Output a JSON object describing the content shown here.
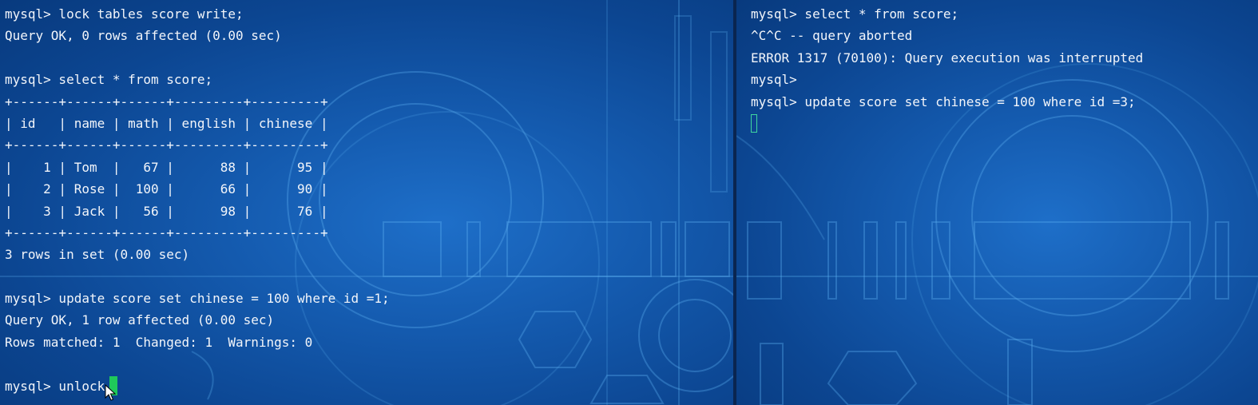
{
  "left_terminal": {
    "lines": [
      "mysql> lock tables score write;",
      "Query OK, 0 rows affected (0.00 sec)",
      "",
      "mysql> select * from score;",
      "+------+------+------+---------+---------+",
      "| id   | name | math | english | chinese |",
      "+------+------+------+---------+---------+",
      "|    1 | Tom  |   67 |      88 |      95 |",
      "|    2 | Rose |  100 |      66 |      90 |",
      "|    3 | Jack |   56 |      98 |      76 |",
      "+------+------+------+---------+---------+",
      "3 rows in set (0.00 sec)",
      "",
      "mysql> update score set chinese = 100 where id =1;",
      "Query OK, 1 row affected (0.00 sec)",
      "Rows matched: 1  Changed: 1  Warnings: 0",
      "",
      "mysql> unlock"
    ]
  },
  "right_terminal": {
    "lines": [
      "mysql> select * from score;",
      "^C^C -- query aborted",
      "ERROR 1317 (70100): Query execution was interrupted",
      "mysql>",
      "mysql> update score set chinese = 100 where id =3;",
      ""
    ]
  },
  "colors": {
    "text": "#f2f5fa",
    "cursor_active": "#1fc95a",
    "cursor_inactive_outline": "#3fd7a0",
    "background_blue": "#145aae"
  },
  "icons": [
    "mouse-pointer-icon",
    "text-cursor"
  ]
}
